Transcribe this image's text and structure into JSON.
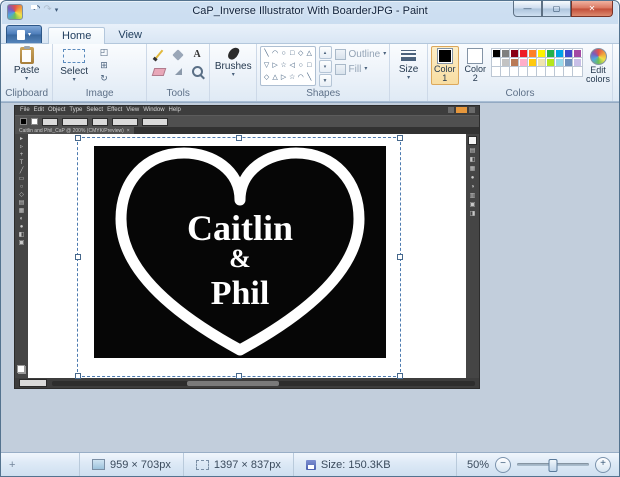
{
  "window": {
    "title": "CaP_Inverse Illustrator With BoarderJPG - Paint",
    "controls": {
      "minimize": "—",
      "maximize": "▢",
      "close": "✕"
    }
  },
  "quick_access": {
    "undo": "↶",
    "redo": "↷",
    "menu_arrow": "▾"
  },
  "tabs": {
    "home": "Home",
    "view": "View"
  },
  "icons": {
    "dropdown_arrow": "▾",
    "crop": "◰",
    "resize": "⊞",
    "rotate": "↻",
    "text_tool": "A",
    "scroll_up": "▴",
    "scroll_down": "▾",
    "scroll_more": "▼",
    "tab_close": "×"
  },
  "ribbon": {
    "clipboard": {
      "group_label": "Clipboard",
      "paste_label": "Paste"
    },
    "image": {
      "group_label": "Image",
      "select_label": "Select"
    },
    "tools": {
      "group_label": "Tools"
    },
    "brushes": {
      "label": "Brushes"
    },
    "shapes": {
      "group_label": "Shapes",
      "outline_label": "Outline",
      "fill_label": "Fill",
      "glyphs": [
        "╲",
        "◠",
        "○",
        "□",
        "◇",
        "△",
        "▽",
        "▷",
        "☆",
        "◁",
        "○",
        "□",
        "◇",
        "△",
        "▷",
        "☆",
        "◠",
        "╲"
      ]
    },
    "size": {
      "label": "Size"
    },
    "colors": {
      "group_label": "Colors",
      "color1_label": "Color 1",
      "color2_label": "Color 2",
      "edit_colors_label": "Edit colors",
      "color1": "#000000",
      "color2": "#ffffff",
      "palette": [
        "#000000",
        "#7f7f7f",
        "#880015",
        "#ed1c24",
        "#ff7f27",
        "#fff200",
        "#22b14c",
        "#00a2e8",
        "#3f48cc",
        "#a349a4",
        "#ffffff",
        "#c3c3c3",
        "#b97a57",
        "#ffaec9",
        "#ffc90e",
        "#efe4b0",
        "#b5e61d",
        "#99d9ea",
        "#7092be",
        "#c8bfe7",
        "#ffffff",
        "#ffffff",
        "#ffffff",
        "#ffffff",
        "#ffffff",
        "#ffffff",
        "#ffffff",
        "#ffffff",
        "#ffffff",
        "#ffffff"
      ]
    }
  },
  "illustrator": {
    "menu": [
      "File",
      "Edit",
      "Object",
      "Type",
      "Select",
      "Effect",
      "View",
      "Window",
      "Help"
    ],
    "doc_tab": "Caitlin and Phil_CaP @ 200% (CMYK/Preview)",
    "artwork": {
      "line1": "Caitlin",
      "line2": "&",
      "line3": "Phil"
    },
    "toolbar_glyphs": [
      "▸",
      "▹",
      "+",
      "T",
      "╱",
      "▭",
      "○",
      "◇",
      "▤",
      "▦",
      "◐",
      "●",
      "◧",
      "▣"
    ],
    "panel_glyphs": [
      "▤",
      "◧",
      "▦",
      "●",
      "◑",
      "▥",
      "▣",
      "◨"
    ]
  },
  "status_bar": {
    "position": "959 × 703px",
    "selection": "1397 × 837px",
    "file_size": "Size: 150.3KB",
    "zoom": "50%",
    "zoom_out": "−",
    "zoom_in": "+"
  }
}
